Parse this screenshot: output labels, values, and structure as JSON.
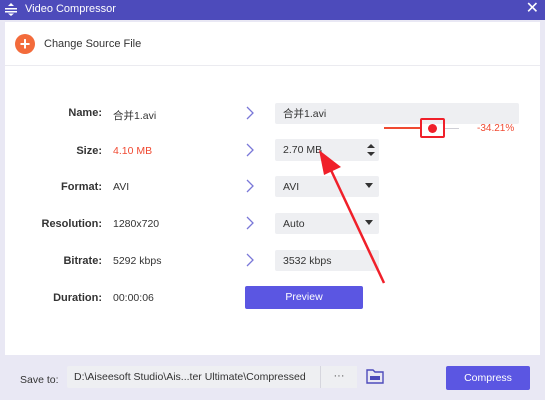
{
  "window": {
    "title": "Video Compressor",
    "close_label": "✕"
  },
  "change_source": {
    "icon": "plus-icon",
    "label": "Change Source File"
  },
  "rows": {
    "name": {
      "label": "Name:",
      "source": "合并1.avi",
      "target": "合并1.avi"
    },
    "size": {
      "label": "Size:",
      "source": "4.10 MB",
      "target": "2.70 MB",
      "percent": "-34.21%",
      "slider_fraction": 0.66
    },
    "format": {
      "label": "Format:",
      "source": "AVI",
      "target": "AVI"
    },
    "resolution": {
      "label": "Resolution:",
      "source": "1280x720",
      "target": "Auto"
    },
    "bitrate": {
      "label": "Bitrate:",
      "source": "5292 kbps",
      "target": "3532 kbps"
    },
    "duration": {
      "label": "Duration:",
      "source": "00:00:06"
    }
  },
  "preview_label": "Preview",
  "save": {
    "label": "Save to:",
    "path": "D:\\Aiseesoft Studio\\Ais...ter Ultimate\\Compressed",
    "dots": "···"
  },
  "compress_label": "Compress",
  "colors": {
    "accent": "#5b56e2",
    "titlebar": "#4d4bbb",
    "highlight": "#f04a32",
    "annotation": "#f0202a"
  }
}
